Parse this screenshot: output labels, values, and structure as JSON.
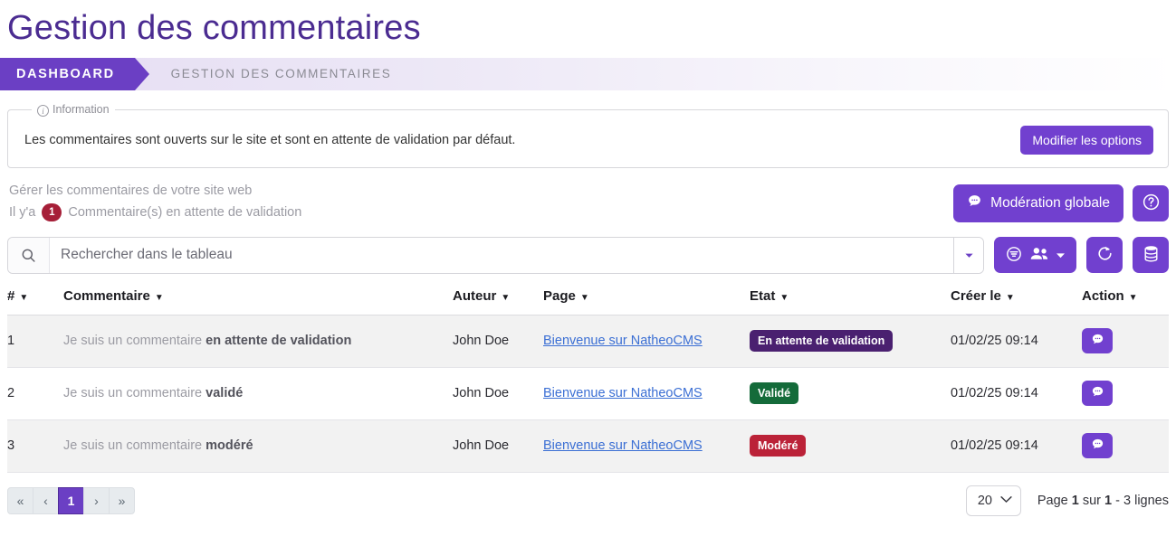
{
  "page_title": "Gestion des commentaires",
  "breadcrumb": {
    "active": "DASHBOARD",
    "current": "GESTION DES COMMENTAIRES"
  },
  "information": {
    "legend": "Information",
    "legend_icon": "info-circle-icon",
    "text": "Les commentaires sont ouverts sur le site et sont en attente de validation par défaut.",
    "button_label": "Modifier les options"
  },
  "subheader": {
    "line1": "Gérer les commentaires de votre site web",
    "count_prefix": "Il y'a",
    "count": "1",
    "count_suffix": "Commentaire(s) en attente de validation",
    "moderation_button": "Modération globale",
    "moderation_icon": "comment-icon",
    "help_icon": "question-circle-icon"
  },
  "toolbar": {
    "search_placeholder": "Rechercher dans le tableau",
    "search_value": "",
    "search_icon": "search-icon",
    "search_caret_icon": "caret-down-icon",
    "filter_users_icon": "filter-circle-icon",
    "users_icon": "users-icon",
    "users_caret_icon": "caret-down-icon",
    "refresh_icon": "refresh-icon",
    "database_icon": "database-icon"
  },
  "table": {
    "columns": [
      {
        "label": "#",
        "name": "id"
      },
      {
        "label": "Commentaire",
        "name": "commentaire"
      },
      {
        "label": "Auteur",
        "name": "auteur"
      },
      {
        "label": "Page",
        "name": "page"
      },
      {
        "label": "Etat",
        "name": "etat"
      },
      {
        "label": "Créer le",
        "name": "creer-le"
      },
      {
        "label": "Action",
        "name": "action"
      }
    ],
    "sort_caret": "▼",
    "rows": [
      {
        "id": "1",
        "comment_plain": "Je suis un commentaire ",
        "comment_bold": "en attente de validation",
        "author": "John Doe",
        "page": "Bienvenue sur NatheoCMS",
        "state": "En attente de validation",
        "state_class": "pending",
        "date": "01/02/25 09:14",
        "action_icon": "comment-icon"
      },
      {
        "id": "2",
        "comment_plain": "Je suis un commentaire ",
        "comment_bold": "validé",
        "author": "John Doe",
        "page": "Bienvenue sur NatheoCMS",
        "state": "Validé",
        "state_class": "valid",
        "date": "01/02/25 09:14",
        "action_icon": "comment-icon"
      },
      {
        "id": "3",
        "comment_plain": "Je suis un commentaire ",
        "comment_bold": "modéré",
        "author": "John Doe",
        "page": "Bienvenue sur NatheoCMS",
        "state": "Modéré",
        "state_class": "moderated",
        "date": "01/02/25 09:14",
        "action_icon": "comment-icon"
      }
    ]
  },
  "footer": {
    "first_label": "«",
    "prev_label": "‹",
    "current_page": "1",
    "next_label": "›",
    "last_label": "»",
    "per_page_value": "20",
    "per_page_options": [
      "20"
    ],
    "page_info_prefix": "Page",
    "page_info_current": "1",
    "page_info_middle": "sur",
    "page_info_total": "1",
    "page_info_suffix": "- 3 lignes"
  },
  "colors": {
    "brand_purple": "#7140cf",
    "title_purple": "#4b2c91",
    "badge_pending": "#4a2070",
    "badge_valid": "#146b3a",
    "badge_moderated": "#bb2238",
    "count_badge_red": "#a61f38",
    "link_blue": "#3b6fd4"
  }
}
